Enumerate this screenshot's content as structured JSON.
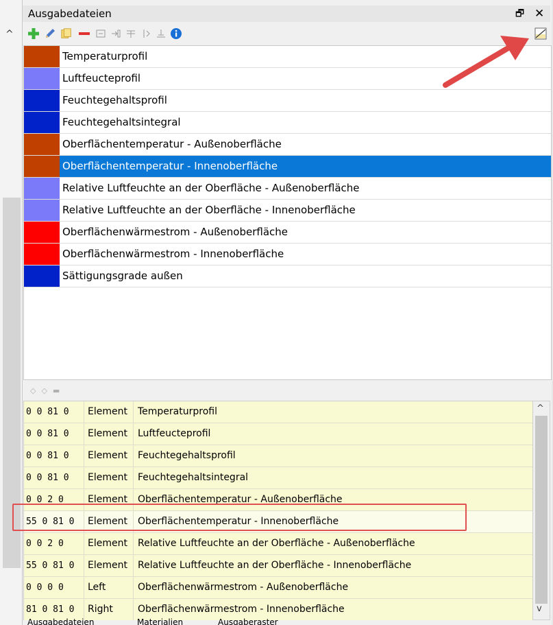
{
  "panel": {
    "title": "Ausgabedateien",
    "float_glyph": "🗗",
    "close_glyph": "✕"
  },
  "toolbar": {
    "icons": [
      "add-icon",
      "edit-icon",
      "copy-icon",
      "remove-icon",
      "export-icon",
      "move-icon",
      "grid-icon",
      "split-icon",
      "align-icon",
      "info-icon",
      "toggle-view-icon"
    ]
  },
  "colors": {
    "brown": "#c04000",
    "lavender": "#7b7bfa",
    "navy": "#0022c8",
    "red": "#ff0000",
    "selection": "#0a78d7",
    "annotation": "#e04848"
  },
  "outputs": [
    {
      "label": "Temperaturprofil",
      "color": "#c04000"
    },
    {
      "label": "Luftfeucteprofil",
      "color": "#7b7bfa"
    },
    {
      "label": "Feuchtegehaltsprofil",
      "color": "#0022c8"
    },
    {
      "label": "Feuchtegehaltsintegral",
      "color": "#0022c8"
    },
    {
      "label": "Oberflächentemperatur - Außenoberfläche",
      "color": "#c04000"
    },
    {
      "label": "Oberflächentemperatur - Innenoberfläche",
      "color": "#c04000",
      "selected": true
    },
    {
      "label": "Relative Luftfeuchte an der Oberfläche - Außenoberfläche",
      "color": "#7b7bfa"
    },
    {
      "label": "Relative Luftfeuchte an der Oberfläche - Innenoberfläche",
      "color": "#7b7bfa"
    },
    {
      "label": "Oberflächenwärmestrom - Außenoberfläche",
      "color": "#ff0000"
    },
    {
      "label": "Oberflächenwärmestrom - Innenoberfläche",
      "color": "#ff0000"
    },
    {
      "label": "Sättigungsgrade außen",
      "color": "#0022c8"
    }
  ],
  "table": {
    "rows": [
      {
        "coords": "0 0 81 0",
        "type": "Element",
        "name": "Temperaturprofil"
      },
      {
        "coords": "0 0 81 0",
        "type": "Element",
        "name": "Luftfeucteprofil"
      },
      {
        "coords": "0 0 81 0",
        "type": "Element",
        "name": "Feuchtegehaltsprofil"
      },
      {
        "coords": "0 0 81 0",
        "type": "Element",
        "name": "Feuchtegehaltsintegral"
      },
      {
        "coords": "0 0 2 0",
        "type": "Element",
        "name": "Oberflächentemperatur - Außenoberfläche"
      },
      {
        "coords": "55 0 81 0",
        "type": "Element",
        "name": "Oberflächentemperatur - Innenoberfläche",
        "highlighted": true
      },
      {
        "coords": "0 0 2 0",
        "type": "Element",
        "name": "Relative Luftfeuchte an der Oberfläche - Außenoberfläche"
      },
      {
        "coords": "55 0 81 0",
        "type": "Element",
        "name": "Relative Luftfeuchte an der Oberfläche - Innenoberfläche"
      },
      {
        "coords": "0 0 0 0",
        "type": "Left",
        "name": "Oberflächenwärmestrom - Außenoberfläche"
      },
      {
        "coords": "81 0 81 0",
        "type": "Right",
        "name": "Oberflächenwärmestrom - Innenoberfläche"
      }
    ]
  },
  "tabs": [
    "Ausgabedateien",
    "Materialien",
    "Ausgaberaster"
  ]
}
